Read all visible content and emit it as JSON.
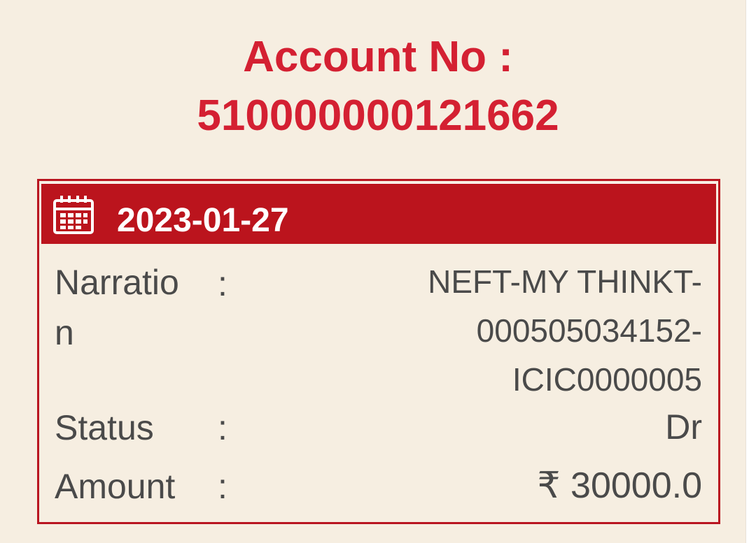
{
  "account": {
    "label": "Account No :",
    "number": "510000000121662"
  },
  "transaction": {
    "date": "2023-01-27",
    "date_icon": "calendar-icon",
    "narration": {
      "label_line1": "Narratio",
      "label_line2": "n",
      "colon": ":",
      "value_lines": [
        "NEFT-MY THINKT-",
        "000505034152-",
        "ICIC0000005"
      ]
    },
    "status": {
      "label": "Status",
      "colon": ":",
      "value": "Dr"
    },
    "amount": {
      "label": "Amount",
      "colon": ":",
      "value": "₹ 30000.0"
    }
  },
  "colors": {
    "accent": "#d42032",
    "header_bar": "#bb141d",
    "background": "#f6eee1",
    "text": "#4a4a4a"
  }
}
